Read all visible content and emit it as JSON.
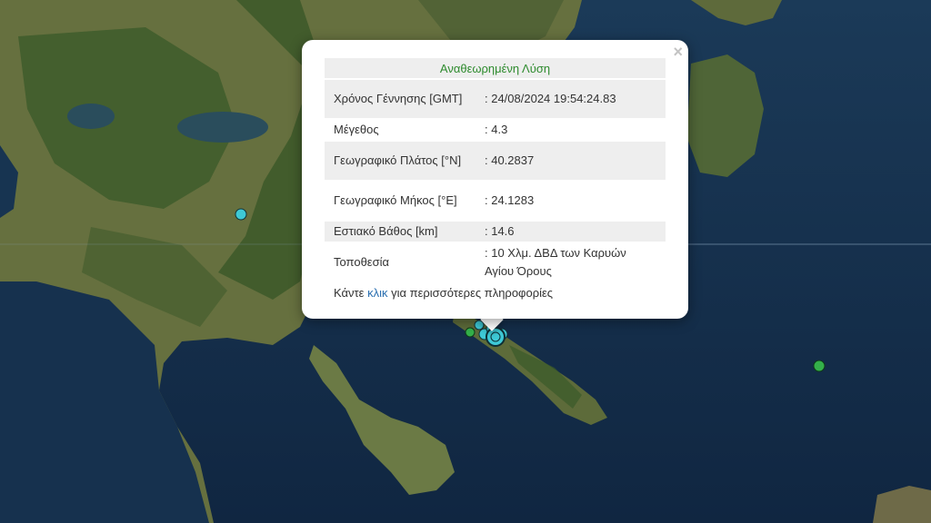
{
  "popup": {
    "title": "Αναθεωρημένη Λύση",
    "close_symbol": "×",
    "rows": [
      {
        "label": "Χρόνος Γέννησης [GMT]",
        "value": ": 24/08/2024 19:54:24.83"
      },
      {
        "label": "Μέγεθος",
        "value": ": 4.3"
      },
      {
        "label": "Γεωγραφικό Πλάτος [°N]",
        "value": ": 40.2837"
      },
      {
        "label": "Γεωγραφικό Μήκος [°E]",
        "value": ": 24.1283"
      },
      {
        "label": "Εστιακό Βάθος [km]",
        "value": ": 14.6"
      },
      {
        "label": "Τοποθεσία",
        "value": ": 10 Χλμ. ΔΒΔ των Καρυών Αγίου Όρους"
      }
    ],
    "more_prefix": "Κάντε ",
    "more_link": "κλικ",
    "more_suffix": " για περισσότερες πληροφορίες"
  },
  "map": {
    "layer": "satellite",
    "colors": {
      "sea": "#17324f",
      "land": "#5f6b3e",
      "forest": "#3c5a2a",
      "marker_cyan": "#3ec9d6",
      "marker_green": "#34b04a"
    },
    "markers": [
      {
        "name": "earthquake-marker-main",
        "color": "cyan",
        "kind": "main"
      },
      {
        "name": "earthquake-marker-cluster",
        "color": "cyan",
        "kind": "cluster"
      },
      {
        "name": "earthquake-marker-inland",
        "color": "cyan",
        "kind": "single"
      },
      {
        "name": "earthquake-marker-aegean",
        "color": "green",
        "kind": "single"
      },
      {
        "name": "earthquake-marker-gulf",
        "color": "green",
        "kind": "single"
      }
    ]
  }
}
